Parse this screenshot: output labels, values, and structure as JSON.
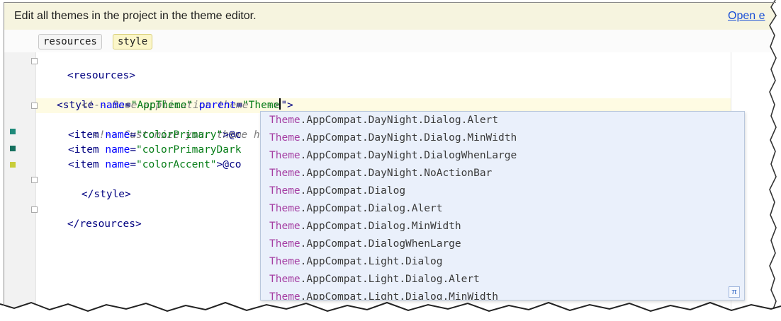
{
  "banner": {
    "text": "Edit all themes in the project in the theme editor.",
    "link": "Open e"
  },
  "breadcrumbs": [
    "resources",
    "style"
  ],
  "code": {
    "line1": {
      "open": "<resources>"
    },
    "line2": {
      "comment": "<!-- Base application theme. -->"
    },
    "line3": {
      "a": "<style ",
      "b": "name",
      "c": "=",
      "d": "\"AppTheme\"",
      "e": " ",
      "f": "parent",
      "g": "=",
      "h": "\"Theme",
      "i": "\">"
    },
    "line4": {
      "comment": "<!-- Customize your theme he"
    },
    "line5": {
      "a": "<item ",
      "b": "name",
      "c": "=",
      "d": "\"colorPrimary\"",
      "e": ">@c"
    },
    "line6": {
      "a": "<item ",
      "b": "name",
      "c": "=",
      "d": "\"colorPrimaryDark"
    },
    "line7": {
      "a": "<item ",
      "b": "name",
      "c": "=",
      "d": "\"colorAccent\"",
      "e": ">@co"
    },
    "line8": {
      "close": "</style>"
    },
    "line9": {
      "close": "</resources>"
    }
  },
  "swatches": {
    "primary": "#1f8a7a",
    "primary_dark": "#16705f",
    "accent": "#c8cd3a"
  },
  "autocomplete": {
    "prefix": "Theme",
    "items": [
      ".AppCompat.DayNight.Dialog.Alert",
      ".AppCompat.DayNight.Dialog.MinWidth",
      ".AppCompat.DayNight.DialogWhenLarge",
      ".AppCompat.DayNight.NoActionBar",
      ".AppCompat.Dialog",
      ".AppCompat.Dialog.Alert",
      ".AppCompat.Dialog.MinWidth",
      ".AppCompat.DialogWhenLarge",
      ".AppCompat.Light.Dialog",
      ".AppCompat.Light.Dialog.Alert",
      ".AppCompat.Light.Dialog.MinWidth"
    ],
    "pi_symbol": "π"
  }
}
